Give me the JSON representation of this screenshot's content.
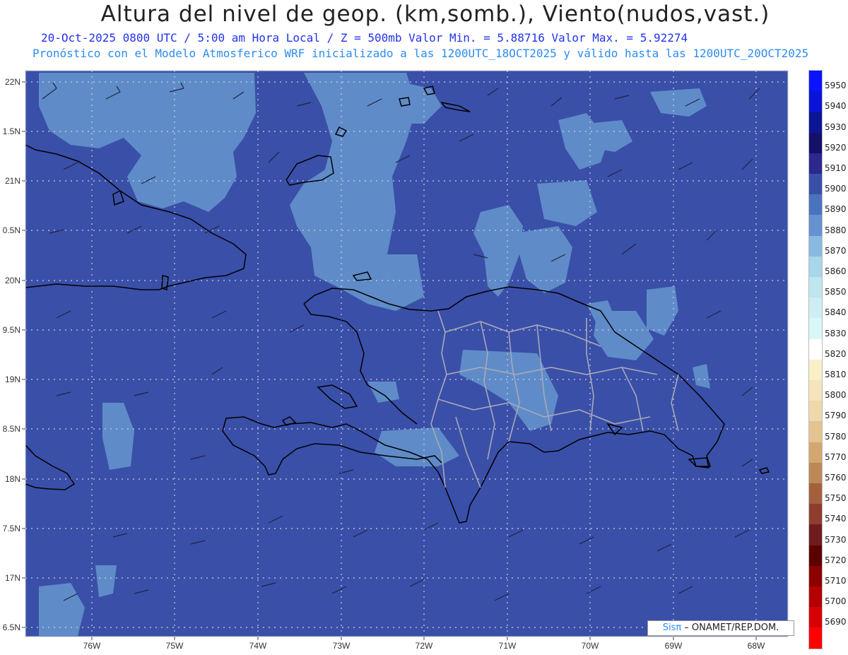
{
  "header": {
    "title": "Altura del nivel de geop. (km,somb.), Viento(nudos,vast.)",
    "line1": "20-Oct-2025  0800 UTC / 5:00 am Hora Local / Z = 500mb    Valor Min. = 5.88716  Valor Max. = 5.92274",
    "line2": "Pronóstico con el Modelo Atmosferico WRF inicializado a las 1200UTC_18OCT2025 y válido hasta las  1200UTC_20OCT2025"
  },
  "axes": {
    "lat_labels": [
      "22N",
      "1.5N",
      "21N",
      "0.5N",
      "20N",
      "9.5N",
      "19N",
      "8.5N",
      "18N",
      "7.5N",
      "17N",
      "6.5N"
    ],
    "lon_labels": [
      "76W",
      "75W",
      "74W",
      "73W",
      "72W",
      "71W",
      "70W",
      "69W",
      "68W"
    ]
  },
  "colorbar": {
    "labels": [
      "5950",
      "5940",
      "5930",
      "5920",
      "5910",
      "5900",
      "5890",
      "5880",
      "5870",
      "5860",
      "5850",
      "5840",
      "5830",
      "5820",
      "5810",
      "5800",
      "5790",
      "5780",
      "5770",
      "5760",
      "5750",
      "5740",
      "5730",
      "5720",
      "5710",
      "5700",
      "5690"
    ],
    "colors": [
      "#0a14ff",
      "#0a14d8",
      "#0b1696",
      "#15106a",
      "#2c2890",
      "#3a4fa8",
      "#4a73be",
      "#6690cf",
      "#89b9e0",
      "#a8d6ea",
      "#bfe6f0",
      "#cdeef4",
      "#d9f7f9",
      "#ffffff",
      "#faf0c8",
      "#f5e4bd",
      "#efd8ab",
      "#e3c390",
      "#d2a870",
      "#bc8856",
      "#a4603d",
      "#8e3d2f",
      "#6e1c1e",
      "#5c0004",
      "#8d0000",
      "#b40000",
      "#d70000",
      "#ff0000"
    ]
  },
  "credit": {
    "brand": "Sisπ",
    "text": " – ONAMET/REP.DOM."
  }
}
